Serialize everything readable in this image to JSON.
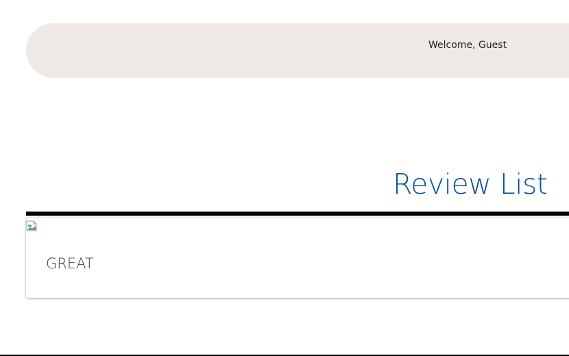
{
  "header": {
    "welcome_text": "Welcome, Guest"
  },
  "main": {
    "title": "Review List",
    "reviews": [
      {
        "title": "GREAT",
        "image": "broken-image-icon"
      }
    ]
  },
  "colors": {
    "header_bg": "#efe9e6",
    "title": "#0a4f93",
    "divider": "#000000"
  }
}
